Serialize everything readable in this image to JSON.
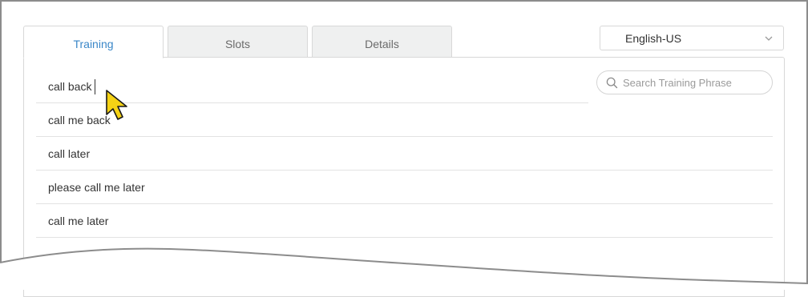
{
  "tabs": [
    {
      "label": "Training",
      "active": true
    },
    {
      "label": "Slots",
      "active": false
    },
    {
      "label": "Details",
      "active": false
    }
  ],
  "language": {
    "selected": "English-US"
  },
  "phrase_input": {
    "value": "call back"
  },
  "search": {
    "placeholder": "Search Training Phrase"
  },
  "phrases": [
    "call me back",
    "call later",
    "please call me later",
    "call me later"
  ],
  "colors": {
    "accent": "#3a87c8",
    "cursor": "#f5d215"
  },
  "icons": {
    "search": "search-icon",
    "dropdown": "chevron-down-icon",
    "pointer": "mouse-pointer-icon"
  }
}
